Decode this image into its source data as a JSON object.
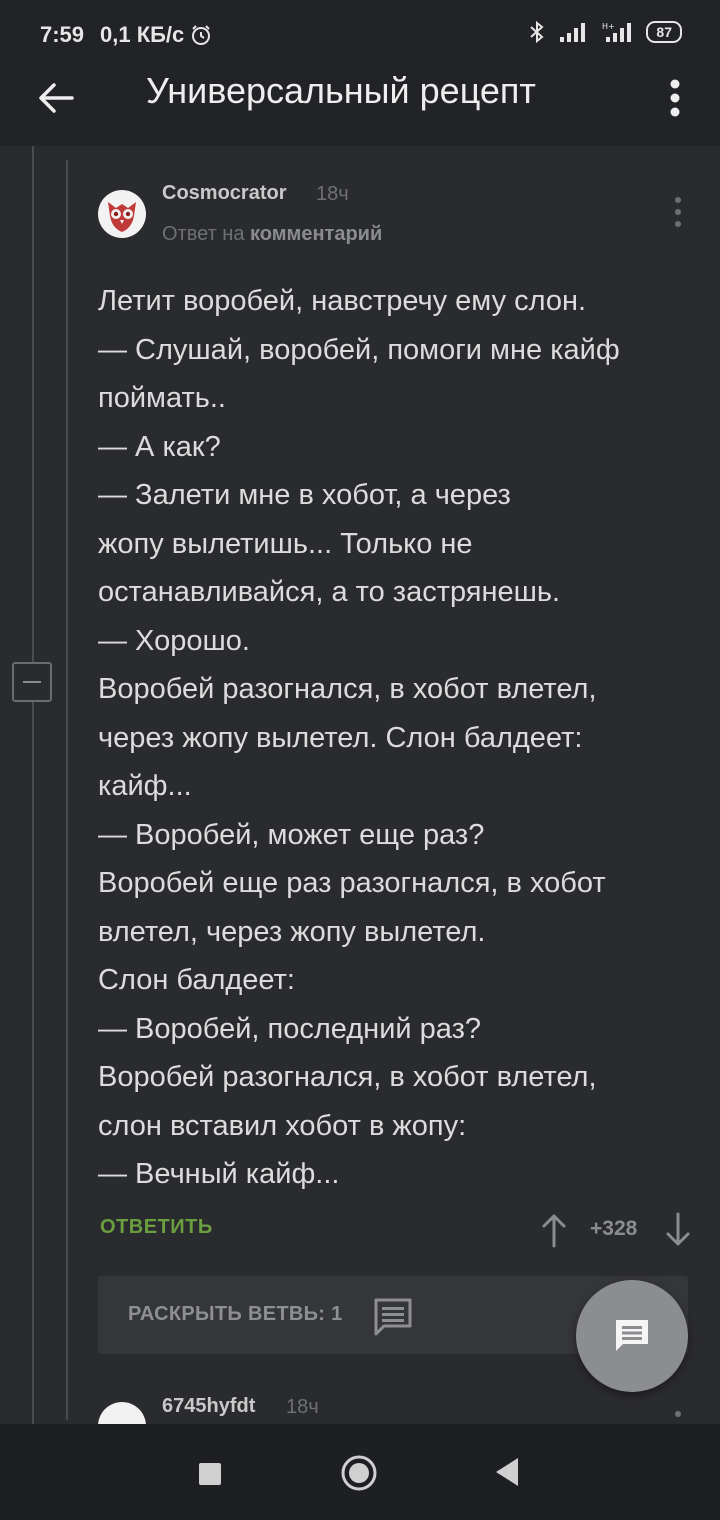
{
  "status_bar": {
    "time": "7:59",
    "speed": "0,1 КБ/с",
    "battery": "87"
  },
  "app_bar": {
    "title": "Универсальный рецепт"
  },
  "comment": {
    "author": "Cosmocrator",
    "time": "18ч",
    "reply_to_prefix": "Ответ на",
    "reply_to_link": "комментарий",
    "lines": [
      "Летит воробей, навстречу ему слон.",
      "— Слушай, воробей, помоги мне кайф",
      "поймать..",
      "— А как?",
      "— Залети мне в хобот, а через",
      "жопу вылетишь... Только не",
      "останавливайся, а то застрянешь.",
      "— Хорошо.",
      "Воробей разогнался, в хобот влетел,",
      "через жопу вылетел. Слон балдеет:",
      "кайф...",
      "— Воробей, может еще раз?",
      "Воробей еще раз разогнался, в хобот",
      "влетел, через жопу вылетел.",
      "Слон балдеет:",
      "— Воробей, последний раз?",
      "Воробей разогнался, в хобот влетел,",
      "слон вставил хобот в жопу:",
      "— Вечный кайф..."
    ],
    "reply_label": "ОТВЕТИТЬ",
    "rating": "+328",
    "expand_label": "РАСКРЫТЬ ВЕТВЬ: 1"
  },
  "next_comment": {
    "author": "6745hyfdt",
    "time": "18ч"
  },
  "colors": {
    "background": "#2a2b2e",
    "bar": "#222326",
    "accent_green": "#6a9e3f",
    "fab": "#8c8d90"
  }
}
